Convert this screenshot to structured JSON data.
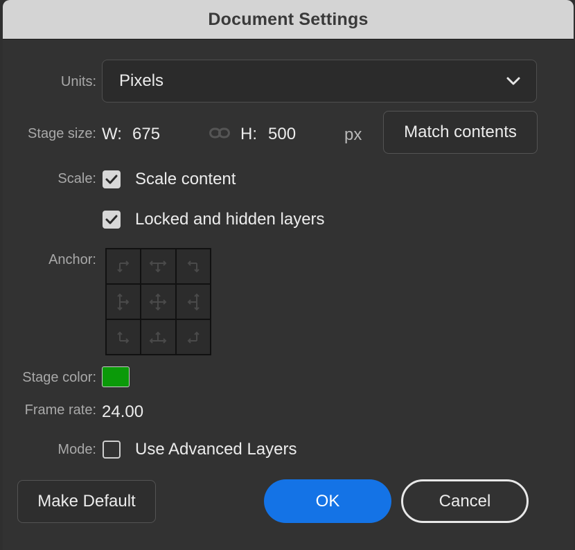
{
  "window": {
    "title": "Document Settings"
  },
  "units": {
    "label": "Units:",
    "selected": "Pixels"
  },
  "stage_size": {
    "label": "Stage size:",
    "w_label": "W:",
    "w_value": "675",
    "h_label": "H:",
    "h_value": "500",
    "unit": "px",
    "match_button": "Match contents"
  },
  "scale": {
    "label": "Scale:",
    "scale_content": {
      "label": "Scale content",
      "checked": true
    },
    "locked_hidden": {
      "label": "Locked and hidden layers",
      "checked": true
    }
  },
  "anchor": {
    "label": "Anchor:"
  },
  "stage_color": {
    "label": "Stage color:",
    "color": "#0b9a09"
  },
  "frame_rate": {
    "label": "Frame rate:",
    "value": "24.00"
  },
  "mode": {
    "label": "Mode:",
    "advanced_layers": {
      "label": "Use Advanced Layers",
      "checked": false
    }
  },
  "buttons": {
    "make_default": "Make Default",
    "ok": "OK",
    "cancel": "Cancel"
  },
  "colors": {
    "accent": "#1473e6",
    "background": "#323232",
    "titlebar": "#d4d4d4"
  }
}
